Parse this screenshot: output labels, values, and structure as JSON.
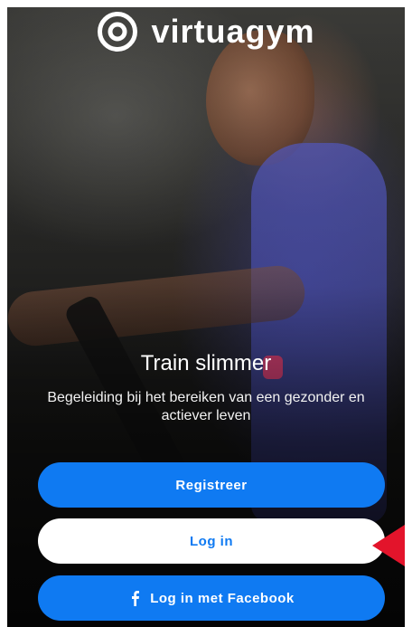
{
  "brand": {
    "name": "virtuagym",
    "logo_icon": "virtuagym-ring-logo"
  },
  "hero": {
    "title": "Train slimmer",
    "subtitle": "Begeleiding bij het bereiken van een gezonder en actiever leven"
  },
  "buttons": {
    "register_label": "Registreer",
    "login_label": "Log in",
    "facebook_label": "Log in met Facebook",
    "facebook_icon": "facebook-f-icon"
  },
  "colors": {
    "primary": "#0f7af2",
    "button_light": "#ffffff",
    "pointer": "#e3142b"
  }
}
